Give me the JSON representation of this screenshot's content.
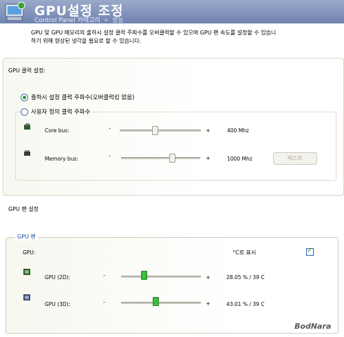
{
  "header": {
    "title": "GPU설정 조정",
    "breadcrumb": {
      "root": "Control Panel",
      "category": "카테고리",
      "separator": "»",
      "current": "성능"
    }
  },
  "description": {
    "line1": "GPU 및 GPU 메모리의 출하시 설정 클럭 주파수를 오버클럭할 수 있으며 GPU 팬 속도를 설정할 수 있습니",
    "line2": "하기 위해 향상된 냉각을 필요로 할 수 있습니다."
  },
  "clock": {
    "section_title": "GPU 클럭 설정:",
    "option_default": "출하시 설정 클럭 주파수(오버클럭킹 없음)",
    "option_custom": "사용자 정의 클럭 주파수",
    "selected": "default",
    "rows": [
      {
        "label": "Core bus:",
        "minus": "-",
        "plus": "+",
        "value": "400 Mhz",
        "slider_fraction": 0.4
      },
      {
        "label": "Memory bus:",
        "minus": "-",
        "plus": "+",
        "value": "1000 Mhz",
        "slider_fraction": 0.6
      }
    ],
    "test_button": "테스트"
  },
  "fan": {
    "section_title": "GPU 팬 설정",
    "legend": "GPU 팬",
    "gpu_label": "GPU:",
    "celsius_label": "°C로 표시",
    "celsius_checked": true,
    "rows": [
      {
        "label": "GPU (2D):",
        "minus": "-",
        "plus": "+",
        "value": "28.05 % / 39 C",
        "slider_fraction": 0.28
      },
      {
        "label": "GPU (3D):",
        "minus": "-",
        "plus": "+",
        "value": "43.01 % / 39 C",
        "slider_fraction": 0.43
      }
    ]
  },
  "watermark": "BodNara"
}
